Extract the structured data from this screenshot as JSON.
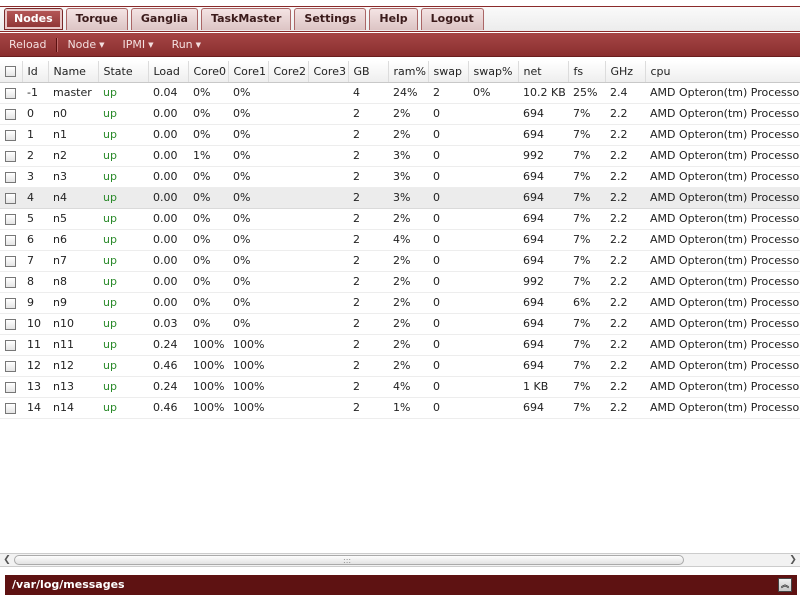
{
  "tabs": [
    {
      "label": "Nodes",
      "active": true
    },
    {
      "label": "Torque",
      "active": false
    },
    {
      "label": "Ganglia",
      "active": false
    },
    {
      "label": "TaskMaster",
      "active": false
    },
    {
      "label": "Settings",
      "active": false
    },
    {
      "label": "Help",
      "active": false
    },
    {
      "label": "Logout",
      "active": false
    }
  ],
  "toolbar": {
    "reload_label": "Reload",
    "node_label": "Node",
    "ipmi_label": "IPMI",
    "run_label": "Run"
  },
  "table": {
    "headers": [
      "Id",
      "Name",
      "State",
      "Load",
      "Core0",
      "Core1",
      "Core2",
      "Core3",
      "GB",
      "ram%",
      "swap",
      "swap%",
      "net",
      "fs",
      "GHz",
      "cpu"
    ],
    "selected_row_index": 5,
    "rows": [
      [
        "-1",
        "master",
        "up",
        "0.04",
        "0%",
        "0%",
        "",
        "",
        "4",
        "24%",
        "2",
        "0%",
        "10.2 KB",
        "25%",
        "2.4",
        "AMD Opteron(tm) Processor"
      ],
      [
        "0",
        "n0",
        "up",
        "0.00",
        "0%",
        "0%",
        "",
        "",
        "2",
        "2%",
        "0",
        "",
        "694",
        "7%",
        "2.2",
        "AMD Opteron(tm) Processor"
      ],
      [
        "1",
        "n1",
        "up",
        "0.00",
        "0%",
        "0%",
        "",
        "",
        "2",
        "2%",
        "0",
        "",
        "694",
        "7%",
        "2.2",
        "AMD Opteron(tm) Processor"
      ],
      [
        "2",
        "n2",
        "up",
        "0.00",
        "1%",
        "0%",
        "",
        "",
        "2",
        "3%",
        "0",
        "",
        "992",
        "7%",
        "2.2",
        "AMD Opteron(tm) Processor"
      ],
      [
        "3",
        "n3",
        "up",
        "0.00",
        "0%",
        "0%",
        "",
        "",
        "2",
        "3%",
        "0",
        "",
        "694",
        "7%",
        "2.2",
        "AMD Opteron(tm) Processor"
      ],
      [
        "4",
        "n4",
        "up",
        "0.00",
        "0%",
        "0%",
        "",
        "",
        "2",
        "3%",
        "0",
        "",
        "694",
        "7%",
        "2.2",
        "AMD Opteron(tm) Processor"
      ],
      [
        "5",
        "n5",
        "up",
        "0.00",
        "0%",
        "0%",
        "",
        "",
        "2",
        "2%",
        "0",
        "",
        "694",
        "7%",
        "2.2",
        "AMD Opteron(tm) Processor"
      ],
      [
        "6",
        "n6",
        "up",
        "0.00",
        "0%",
        "0%",
        "",
        "",
        "2",
        "4%",
        "0",
        "",
        "694",
        "7%",
        "2.2",
        "AMD Opteron(tm) Processor"
      ],
      [
        "7",
        "n7",
        "up",
        "0.00",
        "0%",
        "0%",
        "",
        "",
        "2",
        "2%",
        "0",
        "",
        "694",
        "7%",
        "2.2",
        "AMD Opteron(tm) Processor"
      ],
      [
        "8",
        "n8",
        "up",
        "0.00",
        "0%",
        "0%",
        "",
        "",
        "2",
        "2%",
        "0",
        "",
        "992",
        "7%",
        "2.2",
        "AMD Opteron(tm) Processor"
      ],
      [
        "9",
        "n9",
        "up",
        "0.00",
        "0%",
        "0%",
        "",
        "",
        "2",
        "2%",
        "0",
        "",
        "694",
        "6%",
        "2.2",
        "AMD Opteron(tm) Processor"
      ],
      [
        "10",
        "n10",
        "up",
        "0.03",
        "0%",
        "0%",
        "",
        "",
        "2",
        "2%",
        "0",
        "",
        "694",
        "7%",
        "2.2",
        "AMD Opteron(tm) Processor"
      ],
      [
        "11",
        "n11",
        "up",
        "0.24",
        "100%",
        "100%",
        "",
        "",
        "2",
        "2%",
        "0",
        "",
        "694",
        "7%",
        "2.2",
        "AMD Opteron(tm) Processor"
      ],
      [
        "12",
        "n12",
        "up",
        "0.46",
        "100%",
        "100%",
        "",
        "",
        "2",
        "2%",
        "0",
        "",
        "694",
        "7%",
        "2.2",
        "AMD Opteron(tm) Processor"
      ],
      [
        "13",
        "n13",
        "up",
        "0.24",
        "100%",
        "100%",
        "",
        "",
        "2",
        "4%",
        "0",
        "",
        "1 KB",
        "7%",
        "2.2",
        "AMD Opteron(tm) Processor"
      ],
      [
        "14",
        "n14",
        "up",
        "0.46",
        "100%",
        "100%",
        "",
        "",
        "2",
        "1%",
        "0",
        "",
        "694",
        "7%",
        "2.2",
        "AMD Opteron(tm) Processor"
      ]
    ]
  },
  "scrollbar": {
    "left_arrow_icon": "chevron-left-icon",
    "right_arrow_icon": "chevron-right-icon",
    "grip": ":::"
  },
  "log_panel": {
    "title": "/var/log/messages",
    "collapse_icon": "double-chevron-up-icon"
  },
  "colors": {
    "accent": "#8a2e2e",
    "panel": "#5e1212",
    "state_up": "#2a8a2a"
  }
}
